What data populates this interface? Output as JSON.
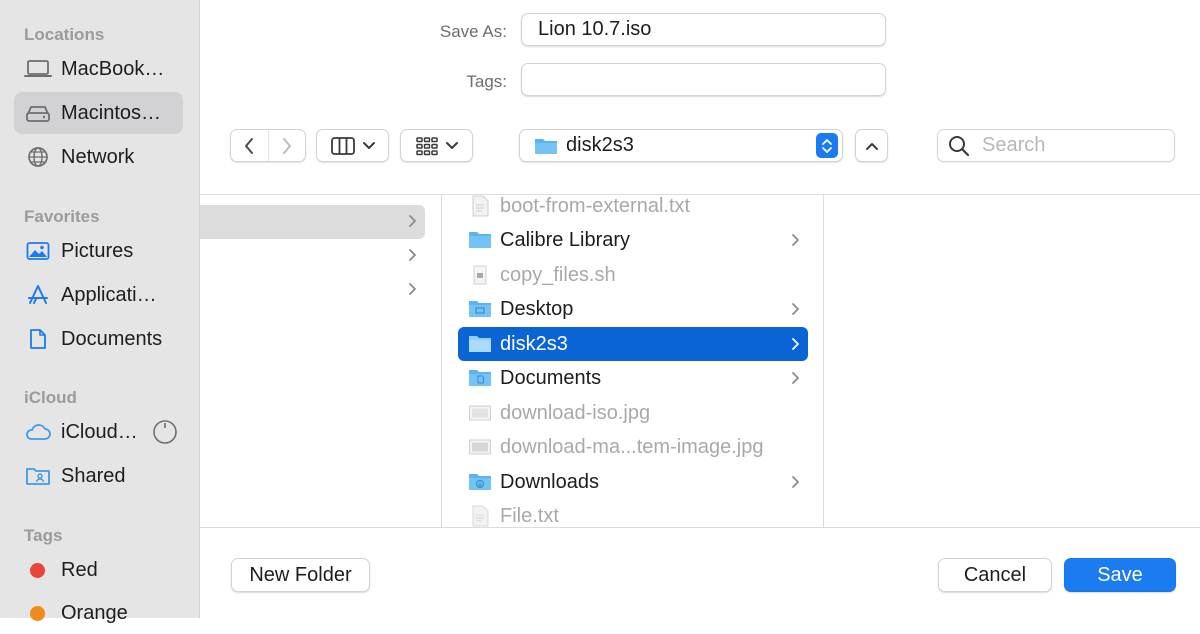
{
  "sidebar": {
    "sections": [
      {
        "heading": "Locations",
        "items": [
          {
            "label": "MacBook…",
            "icon": "laptop-icon"
          },
          {
            "label": "Macintos…",
            "icon": "hard-drive-icon",
            "selected": true
          },
          {
            "label": "Network",
            "icon": "globe-icon"
          }
        ]
      },
      {
        "heading": "Favorites",
        "items": [
          {
            "label": "Pictures",
            "icon": "pictures-icon"
          },
          {
            "label": "Applicati…",
            "icon": "applications-icon"
          },
          {
            "label": "Documents",
            "icon": "document-icon"
          }
        ]
      },
      {
        "heading": "iCloud",
        "items": [
          {
            "label": "iCloud…",
            "icon": "cloud-icon"
          },
          {
            "label": "Shared",
            "icon": "shared-folder-icon"
          }
        ]
      },
      {
        "heading": "Tags",
        "items": [
          {
            "label": "Red",
            "color": "#e9443a"
          },
          {
            "label": "Orange",
            "color": "#f08a1c"
          }
        ]
      }
    ]
  },
  "save_as": {
    "label": "Save As:",
    "value": "Lion 10.7.iso"
  },
  "tags": {
    "label": "Tags:",
    "value": ""
  },
  "location": {
    "name": "disk2s3"
  },
  "search": {
    "placeholder": "Search"
  },
  "files": [
    {
      "name": "boot-from-external.txt",
      "kind": "text",
      "dim": true,
      "folder": false
    },
    {
      "name": "Calibre Library",
      "kind": "folder",
      "dim": false,
      "folder": true
    },
    {
      "name": "copy_files.sh",
      "kind": "script",
      "dim": true,
      "folder": false
    },
    {
      "name": "Desktop",
      "kind": "desktop-folder",
      "dim": false,
      "folder": true
    },
    {
      "name": "disk2s3",
      "kind": "folder",
      "dim": false,
      "folder": true,
      "selected": true
    },
    {
      "name": "Documents",
      "kind": "documents-folder",
      "dim": false,
      "folder": true
    },
    {
      "name": "download-iso.jpg",
      "kind": "image",
      "dim": true,
      "folder": false
    },
    {
      "name": "download-ma...tem-image.jpg",
      "kind": "image",
      "dim": true,
      "folder": false
    },
    {
      "name": "Downloads",
      "kind": "downloads-folder",
      "dim": false,
      "folder": true
    },
    {
      "name": "File.txt",
      "kind": "text",
      "dim": true,
      "folder": false
    }
  ],
  "buttons": {
    "new_folder": "New Folder",
    "cancel": "Cancel",
    "save": "Save"
  },
  "colors": {
    "accent": "#1a7cf0",
    "selection": "#0b64d6",
    "folder": "#5bb3ef"
  }
}
